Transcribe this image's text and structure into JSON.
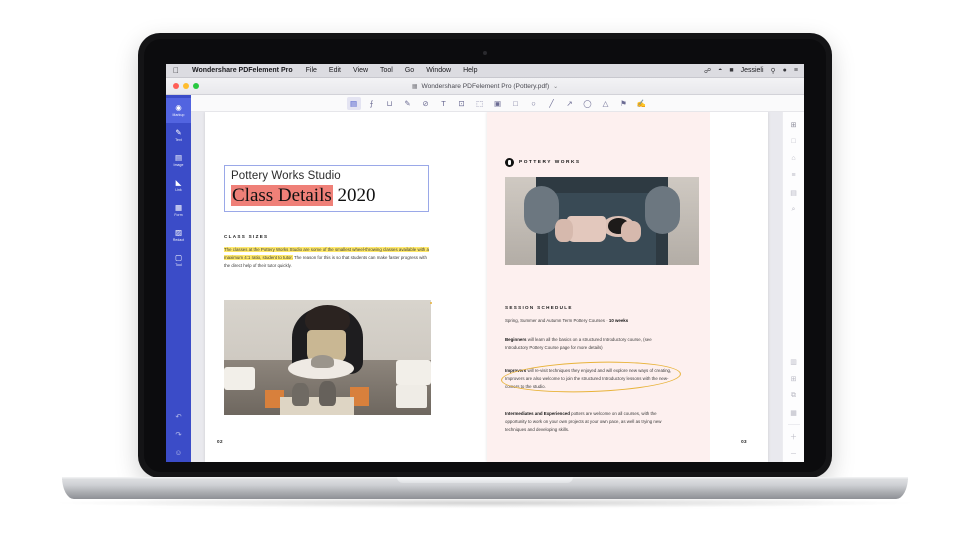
{
  "menubar": {
    "apple_icon": "apple-icon",
    "app_name": "Wondershare PDFelement Pro",
    "items": [
      "File",
      "Edit",
      "View",
      "Tool",
      "Go",
      "Window",
      "Help"
    ],
    "status_icons": [
      "bluetooth-icon",
      "wifi-icon",
      "battery-icon"
    ],
    "user": "Jessieli",
    "right_icons": [
      "search-icon",
      "siri-icon",
      "control-center-icon"
    ]
  },
  "window": {
    "document_title": "Wondershare PDFelement Pro (Pottery.pdf)",
    "title_doc_icon": "document-icon",
    "title_chevron": "chevron-down-icon",
    "traffic_lights": [
      "close",
      "minimize",
      "maximize"
    ]
  },
  "left_rail": {
    "items": [
      {
        "label": "Markup",
        "icon": "markup-icon",
        "active": true
      },
      {
        "label": "Text",
        "icon": "pencil-icon",
        "active": false
      },
      {
        "label": "Image",
        "icon": "image-icon",
        "active": false
      },
      {
        "label": "Link",
        "icon": "link-icon",
        "active": false
      },
      {
        "label": "Form",
        "icon": "form-icon",
        "active": false
      },
      {
        "label": "Redact",
        "icon": "redact-icon",
        "active": false
      },
      {
        "label": "Tool",
        "icon": "tool-icon",
        "active": false
      }
    ],
    "bottom_items": [
      {
        "label": "",
        "icon": "undo-icon"
      },
      {
        "label": "",
        "icon": "redo-icon"
      },
      {
        "label": "",
        "icon": "account-icon"
      }
    ]
  },
  "toolbar": {
    "buttons": [
      {
        "icon": "highlight-icon",
        "glyph": "▤",
        "active": true
      },
      {
        "icon": "strikethrough-icon",
        "glyph": "⨍"
      },
      {
        "icon": "underline-icon",
        "glyph": "⊔"
      },
      {
        "icon": "pencil-icon",
        "glyph": "✎"
      },
      {
        "icon": "eraser-icon",
        "glyph": "⊘"
      },
      {
        "icon": "text-icon",
        "glyph": "T"
      },
      {
        "icon": "text-box-icon",
        "glyph": "⊡"
      },
      {
        "icon": "callout-icon",
        "glyph": "⬚"
      },
      {
        "icon": "note-icon",
        "glyph": "▣"
      },
      {
        "icon": "rectangle-icon",
        "glyph": "□"
      },
      {
        "icon": "ellipse-icon",
        "glyph": "○"
      },
      {
        "icon": "line-icon",
        "glyph": "╱"
      },
      {
        "icon": "arrow-icon",
        "glyph": "↗"
      },
      {
        "icon": "oval-icon",
        "glyph": "◯"
      },
      {
        "icon": "triangle-icon",
        "glyph": "△"
      },
      {
        "icon": "stamp-icon",
        "glyph": "⚑"
      },
      {
        "icon": "signature-icon",
        "glyph": "✍"
      }
    ]
  },
  "right_rail": {
    "top_items": [
      {
        "icon": "thumbnails-icon",
        "glyph": "⊞",
        "active": true
      },
      {
        "icon": "page-icon",
        "glyph": "□"
      },
      {
        "icon": "bookmark-icon",
        "glyph": "⌂"
      },
      {
        "icon": "outline-icon",
        "glyph": "≡"
      },
      {
        "icon": "comments-icon",
        "glyph": "▤"
      },
      {
        "icon": "search-icon",
        "glyph": "⌕"
      }
    ],
    "bottom_items": [
      {
        "icon": "page-layout-icon",
        "glyph": "▥"
      },
      {
        "icon": "page-add-icon",
        "glyph": "⊞"
      },
      {
        "icon": "page-extract-icon",
        "glyph": "⧉"
      },
      {
        "icon": "page-grid-icon",
        "glyph": "▦"
      },
      {
        "icon": "zoom-in-icon",
        "glyph": "＋"
      },
      {
        "icon": "zoom-out-icon",
        "glyph": "－"
      }
    ]
  },
  "document": {
    "left_page": {
      "title_line1": "Pottery Works Studio",
      "title_line2_highlight": "Class Details",
      "title_line2_rest": " 2020",
      "section_heading": "CLASS SIZES",
      "paragraph_highlighted": "The classes at the Pottery Works Studio are some of the smallest wheel-throwing classes available with a maximum 4:1 ratio, student to tutor.",
      "paragraph_rest": " The reason for this is so that students can make faster progress with the direct help of their tutor quickly.",
      "photo_alt": "woman-at-pottery-wheel-photo",
      "page_number": "02"
    },
    "right_page": {
      "brand": "POTTERY WORKS",
      "brand_mark": "pottery-logo-icon",
      "photo_alt": "hands-holding-ceramic-mugs-photo",
      "section_heading": "SESSION SCHEDULE",
      "line_schedule_pre": "Spring, Summer and Autumn Term Pottery Courses · ",
      "line_schedule_bold": "10 weeks",
      "p1_bold": "Beginners",
      "p1_rest": " will learn all the basics on a structured Introductory course, (see Introductory Pottery Course page for more details)",
      "p2_bold": "Improvers",
      "p2_rest": " will re-visit techniques they enjoyed and will explore new ways of creating, Improvers are also welcome to join the structured Introductory lessons with the new-comers to the studio.",
      "p3_bold": "Intermediates and Experienced",
      "p3_rest": " potters are welcome on all courses, with the opportunity to work on your own projects at your own pace, as well as trying new techniques and developing skills.",
      "page_number": "03"
    },
    "annotations": {
      "circle_color": "#e8b33a",
      "highlight_yellow": "#ffe96b",
      "highlight_red": "#ef8078"
    }
  },
  "colors": {
    "rail_blue": "#3b4cc8",
    "rail_blue_active": "#5264e0",
    "page_pink": "#fdf0ef",
    "canvas_gray": "#e9e9ee"
  }
}
